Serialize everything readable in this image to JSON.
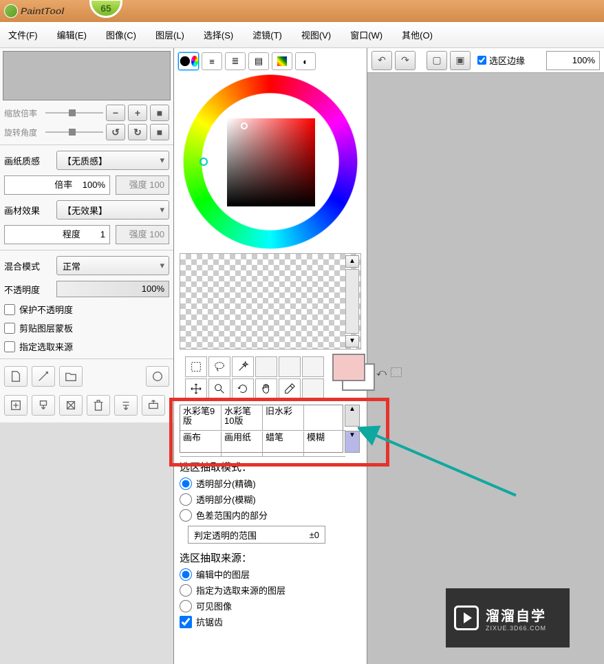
{
  "app": {
    "title": "PaintTool",
    "badge": "65"
  },
  "menu": [
    "文件(F)",
    "编辑(E)",
    "图像(C)",
    "图层(L)",
    "选择(S)",
    "滤镜(T)",
    "视图(V)",
    "窗口(W)",
    "其他(O)"
  ],
  "right_top": {
    "selection_edge_label": "选区边缘",
    "zoom": "100%"
  },
  "left": {
    "slider1": "缩放倍率",
    "slider2": "旋转角度",
    "paper_texture_label": "画纸质感",
    "paper_texture_value": "【无质感】",
    "scale_label": "倍率",
    "scale_value": "100%",
    "strength_label": "强度",
    "strength_value": "100",
    "material_label": "画材效果",
    "material_value": "【无效果】",
    "degree_label": "程度",
    "degree_value": "1",
    "strength2_label": "强度",
    "strength2_value": "100",
    "blend_label": "混合模式",
    "blend_value": "正常",
    "opacity_label": "不透明度",
    "opacity_value": "100%",
    "protect": "保护不透明度",
    "clip": "剪贴图层蒙板",
    "assign_src": "指定选取来源"
  },
  "brushes": {
    "r1": [
      "水彩笔9版",
      "水彩笔10版",
      "旧水彩"
    ],
    "r2": [
      "画布",
      "画用纸",
      "蜡笔",
      "模糊"
    ]
  },
  "extract": {
    "mode_label": "选区抽取模式：",
    "opt1": "透明部分(精确)",
    "opt2": "透明部分(模糊)",
    "opt3": "色差范围内的部分",
    "range_label": "判定透明的范围",
    "range_value": "±0",
    "source_label": "选区抽取来源：",
    "src1": "编辑中的图层",
    "src2": "指定为选取来源的图层",
    "src3": "可见图像",
    "antialias": "抗锯齿"
  },
  "watermark": {
    "brand": "溜溜自学",
    "url": "ZIXUE.3D66.COM"
  },
  "colors": {
    "accent": "#e5332a",
    "arrow": "#0fa8a0"
  }
}
